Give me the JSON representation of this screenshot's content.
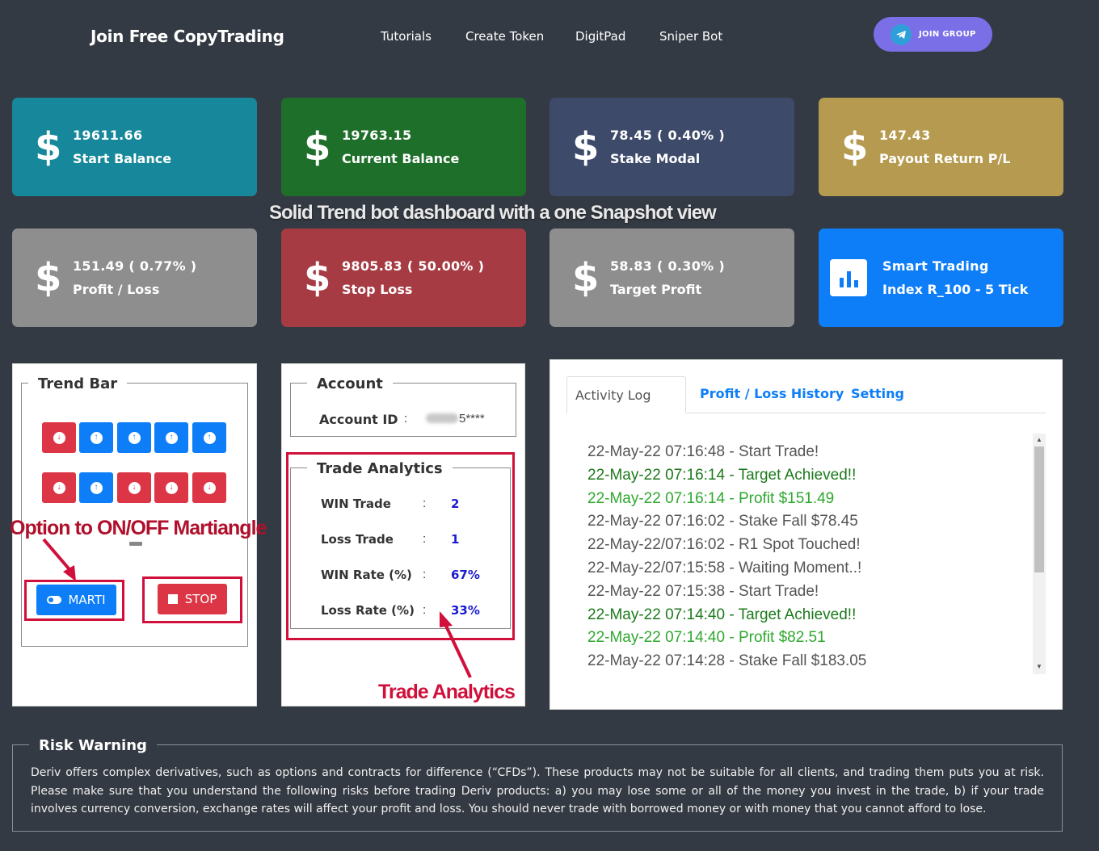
{
  "nav": {
    "brand": "Join Free CopyTrading",
    "links": [
      "Tutorials",
      "Create Token",
      "DigitPad",
      "Sniper Bot"
    ],
    "join_label": "JOIN GROUP"
  },
  "cards": [
    {
      "value": "19611.66",
      "label": "Start Balance",
      "color": "#17889b",
      "icon": "dollar-icon"
    },
    {
      "value": "19763.15",
      "label": "Current Balance",
      "color": "#1e6f2a",
      "icon": "dollar-icon"
    },
    {
      "value": "78.45 ( 0.40% )",
      "label": "Stake Modal",
      "color": "#3d4a6a",
      "icon": "dollar-icon"
    },
    {
      "value": "147.43",
      "label": "Payout Return P/L",
      "color": "#b59a4f",
      "icon": "dollar-icon"
    },
    {
      "value": "151.49 ( 0.77% )",
      "label": "Profit / Loss",
      "color": "#8e8e8e",
      "icon": "dollar-icon"
    },
    {
      "value": "9805.83 ( 50.00% )",
      "label": "Stop Loss",
      "color": "#a63b43",
      "icon": "dollar-icon"
    },
    {
      "value": "58.83 ( 0.30% )",
      "label": "Target Profit",
      "color": "#8e8e8e",
      "icon": "dollar-icon"
    },
    {
      "value": "Smart Trading",
      "label": "Index R_100 - 5 Tick",
      "color": "#0d7ef7",
      "icon": "bar-chart-icon"
    }
  ],
  "overlay_title": "Solid Trend bot dashboard with a one Snapshot view",
  "trend_bar": {
    "title": "Trend Bar",
    "row1": [
      "down",
      "up",
      "up",
      "up",
      "up"
    ],
    "row2": [
      "down",
      "up",
      "down",
      "down",
      "down"
    ],
    "annotation": "Option to ON/OFF Martiangle",
    "marti_label": "MARTI",
    "stop_label": "STOP"
  },
  "account": {
    "title": "Account",
    "id_label": "Account ID",
    "id_value": "5****"
  },
  "analytics": {
    "title": "Trade Analytics",
    "rows": [
      {
        "label": "WIN Trade",
        "value": "2"
      },
      {
        "label": "Loss Trade",
        "value": "1"
      },
      {
        "label": "WIN Rate (%)",
        "value": "67%"
      },
      {
        "label": "Loss Rate (%)",
        "value": "33%"
      }
    ],
    "annotation": "Trade Analytics"
  },
  "activity": {
    "tabs": [
      "Activity Log",
      "Profit / Loss History",
      "Setting"
    ],
    "log": [
      {
        "text": "22-May-22 07:16:48 - Start Trade!",
        "color": "#555555"
      },
      {
        "text": "22-May-22 07:16:14 - Target Achieved!!",
        "color": "#1c7a1c"
      },
      {
        "text": "22-May-22 07:16:14 - Profit $151.49",
        "color": "#2ea82e"
      },
      {
        "text": "22-May-22 07:16:02 - Stake Fall $78.45",
        "color": "#555555"
      },
      {
        "text": "22-May-22/07:16:02 - R1 Spot Touched!",
        "color": "#555555"
      },
      {
        "text": "22-May-22/07:15:58 - Waiting Moment..!",
        "color": "#555555"
      },
      {
        "text": "22-May-22 07:15:38 - Start Trade!",
        "color": "#555555"
      },
      {
        "text": "22-May-22 07:14:40 - Target Achieved!!",
        "color": "#1c7a1c"
      },
      {
        "text": "22-May-22 07:14:40 - Profit $82.51",
        "color": "#2ea82e"
      },
      {
        "text": "22-May-22 07:14:28 - Stake Fall $183.05",
        "color": "#555555"
      }
    ]
  },
  "risk": {
    "title": "Risk Warning",
    "body": "Deriv offers complex derivatives, such as options and contracts for difference (“CFDs”). These products may not be suitable for all clients, and trading them puts you at risk. Please make sure that you understand the following risks before trading Deriv products: a) you may lose some or all of the money you invest in the trade, b) if your trade involves currency conversion, exchange rates will affect your profit and loss. You should never trade with borrowed money or with money that you cannot afford to lose."
  }
}
